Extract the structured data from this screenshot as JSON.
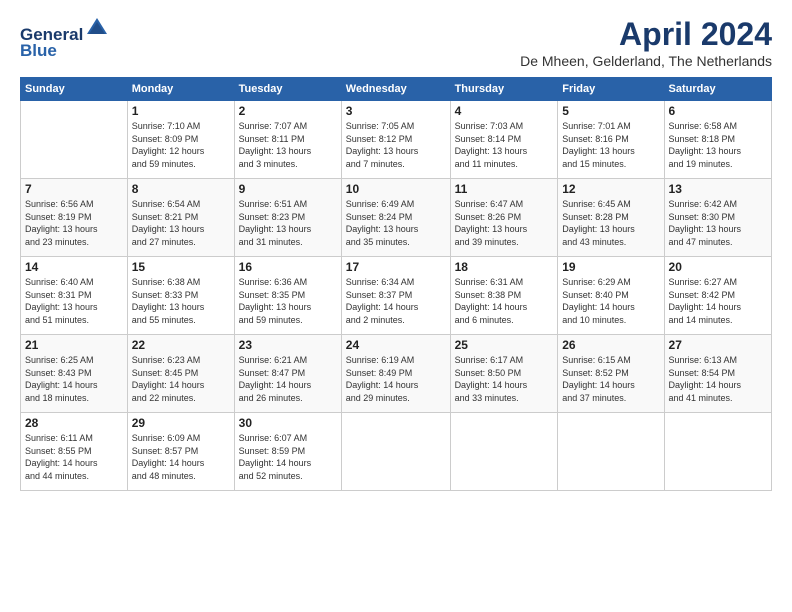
{
  "header": {
    "logo_line1": "General",
    "logo_line2": "Blue",
    "month_title": "April 2024",
    "location": "De Mheen, Gelderland, The Netherlands"
  },
  "days_of_week": [
    "Sunday",
    "Monday",
    "Tuesday",
    "Wednesday",
    "Thursday",
    "Friday",
    "Saturday"
  ],
  "weeks": [
    [
      {
        "day": "",
        "info": ""
      },
      {
        "day": "1",
        "info": "Sunrise: 7:10 AM\nSunset: 8:09 PM\nDaylight: 12 hours\nand 59 minutes."
      },
      {
        "day": "2",
        "info": "Sunrise: 7:07 AM\nSunset: 8:11 PM\nDaylight: 13 hours\nand 3 minutes."
      },
      {
        "day": "3",
        "info": "Sunrise: 7:05 AM\nSunset: 8:12 PM\nDaylight: 13 hours\nand 7 minutes."
      },
      {
        "day": "4",
        "info": "Sunrise: 7:03 AM\nSunset: 8:14 PM\nDaylight: 13 hours\nand 11 minutes."
      },
      {
        "day": "5",
        "info": "Sunrise: 7:01 AM\nSunset: 8:16 PM\nDaylight: 13 hours\nand 15 minutes."
      },
      {
        "day": "6",
        "info": "Sunrise: 6:58 AM\nSunset: 8:18 PM\nDaylight: 13 hours\nand 19 minutes."
      }
    ],
    [
      {
        "day": "7",
        "info": "Sunrise: 6:56 AM\nSunset: 8:19 PM\nDaylight: 13 hours\nand 23 minutes."
      },
      {
        "day": "8",
        "info": "Sunrise: 6:54 AM\nSunset: 8:21 PM\nDaylight: 13 hours\nand 27 minutes."
      },
      {
        "day": "9",
        "info": "Sunrise: 6:51 AM\nSunset: 8:23 PM\nDaylight: 13 hours\nand 31 minutes."
      },
      {
        "day": "10",
        "info": "Sunrise: 6:49 AM\nSunset: 8:24 PM\nDaylight: 13 hours\nand 35 minutes."
      },
      {
        "day": "11",
        "info": "Sunrise: 6:47 AM\nSunset: 8:26 PM\nDaylight: 13 hours\nand 39 minutes."
      },
      {
        "day": "12",
        "info": "Sunrise: 6:45 AM\nSunset: 8:28 PM\nDaylight: 13 hours\nand 43 minutes."
      },
      {
        "day": "13",
        "info": "Sunrise: 6:42 AM\nSunset: 8:30 PM\nDaylight: 13 hours\nand 47 minutes."
      }
    ],
    [
      {
        "day": "14",
        "info": "Sunrise: 6:40 AM\nSunset: 8:31 PM\nDaylight: 13 hours\nand 51 minutes."
      },
      {
        "day": "15",
        "info": "Sunrise: 6:38 AM\nSunset: 8:33 PM\nDaylight: 13 hours\nand 55 minutes."
      },
      {
        "day": "16",
        "info": "Sunrise: 6:36 AM\nSunset: 8:35 PM\nDaylight: 13 hours\nand 59 minutes."
      },
      {
        "day": "17",
        "info": "Sunrise: 6:34 AM\nSunset: 8:37 PM\nDaylight: 14 hours\nand 2 minutes."
      },
      {
        "day": "18",
        "info": "Sunrise: 6:31 AM\nSunset: 8:38 PM\nDaylight: 14 hours\nand 6 minutes."
      },
      {
        "day": "19",
        "info": "Sunrise: 6:29 AM\nSunset: 8:40 PM\nDaylight: 14 hours\nand 10 minutes."
      },
      {
        "day": "20",
        "info": "Sunrise: 6:27 AM\nSunset: 8:42 PM\nDaylight: 14 hours\nand 14 minutes."
      }
    ],
    [
      {
        "day": "21",
        "info": "Sunrise: 6:25 AM\nSunset: 8:43 PM\nDaylight: 14 hours\nand 18 minutes."
      },
      {
        "day": "22",
        "info": "Sunrise: 6:23 AM\nSunset: 8:45 PM\nDaylight: 14 hours\nand 22 minutes."
      },
      {
        "day": "23",
        "info": "Sunrise: 6:21 AM\nSunset: 8:47 PM\nDaylight: 14 hours\nand 26 minutes."
      },
      {
        "day": "24",
        "info": "Sunrise: 6:19 AM\nSunset: 8:49 PM\nDaylight: 14 hours\nand 29 minutes."
      },
      {
        "day": "25",
        "info": "Sunrise: 6:17 AM\nSunset: 8:50 PM\nDaylight: 14 hours\nand 33 minutes."
      },
      {
        "day": "26",
        "info": "Sunrise: 6:15 AM\nSunset: 8:52 PM\nDaylight: 14 hours\nand 37 minutes."
      },
      {
        "day": "27",
        "info": "Sunrise: 6:13 AM\nSunset: 8:54 PM\nDaylight: 14 hours\nand 41 minutes."
      }
    ],
    [
      {
        "day": "28",
        "info": "Sunrise: 6:11 AM\nSunset: 8:55 PM\nDaylight: 14 hours\nand 44 minutes."
      },
      {
        "day": "29",
        "info": "Sunrise: 6:09 AM\nSunset: 8:57 PM\nDaylight: 14 hours\nand 48 minutes."
      },
      {
        "day": "30",
        "info": "Sunrise: 6:07 AM\nSunset: 8:59 PM\nDaylight: 14 hours\nand 52 minutes."
      },
      {
        "day": "",
        "info": ""
      },
      {
        "day": "",
        "info": ""
      },
      {
        "day": "",
        "info": ""
      },
      {
        "day": "",
        "info": ""
      }
    ]
  ]
}
